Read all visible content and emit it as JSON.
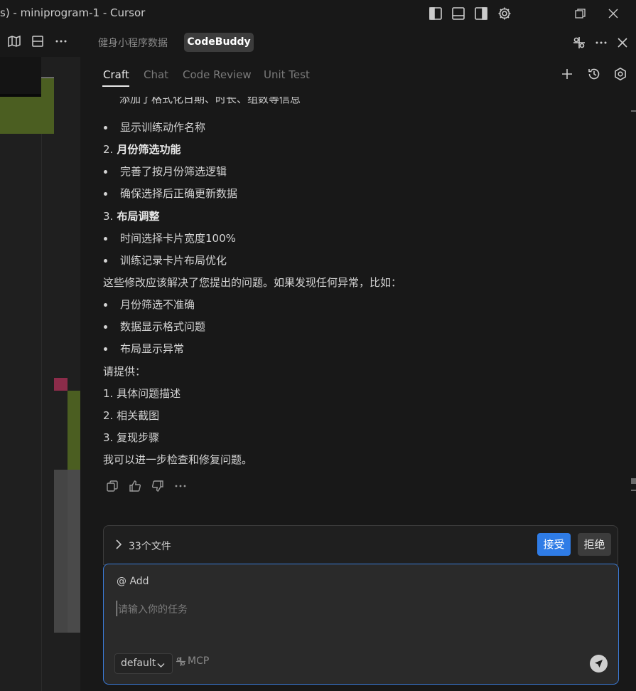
{
  "window": {
    "title": "s) - miniprogram-1 - Cursor"
  },
  "panel": {
    "inactive_tab": "健身小程序数据",
    "active_tab": "CodeBuddy",
    "subtabs": [
      "Craft",
      "Chat",
      "Code Review",
      "Unit Test"
    ]
  },
  "chat": {
    "cut_line": "添加了格式化日期、时长、组数等信息",
    "lines": [
      {
        "type": "bullet",
        "text": "显示训练动作名称"
      },
      {
        "type": "numbered",
        "num": "2.",
        "text": "月份筛选功能"
      },
      {
        "type": "bullet",
        "text": "完善了按月份筛选逻辑"
      },
      {
        "type": "bullet",
        "text": "确保选择后正确更新数据"
      },
      {
        "type": "numbered",
        "num": "3.",
        "text": "布局调整"
      },
      {
        "type": "bullet",
        "text": "时间选择卡片宽度100%"
      },
      {
        "type": "bullet",
        "text": "训练记录卡片布局优化"
      },
      {
        "type": "para",
        "text": "这些修改应该解决了您提出的问题。如果发现任何异常，比如："
      },
      {
        "type": "bullet",
        "text": "月份筛选不准确"
      },
      {
        "type": "bullet",
        "text": "数据显示格式问题"
      },
      {
        "type": "bullet",
        "text": "布局显示异常"
      },
      {
        "type": "para",
        "text": "请提供："
      },
      {
        "type": "para",
        "text": "1. 具体问题描述"
      },
      {
        "type": "para",
        "text": "2. 相关截图"
      },
      {
        "type": "para",
        "text": "3. 复现步骤"
      },
      {
        "type": "para",
        "text": "我可以进一步检查和修复问题。"
      }
    ]
  },
  "files": {
    "label": "33个文件",
    "accept_label": "接受",
    "reject_label": "拒绝"
  },
  "input": {
    "add_label": "@ Add",
    "placeholder": "请输入你的任务",
    "model": "default",
    "mcp_label": "MCP"
  },
  "colors": {
    "accent": "#2f7ce6",
    "input_border": "#3b7ad6",
    "code_green": "#4b5e21",
    "code_pink": "#8c2c4a"
  },
  "icons": [
    "map-icon",
    "split-editor-icon",
    "ellipsis-icon",
    "toggle-primary-sidebar-icon",
    "toggle-panel-icon",
    "toggle-secondary-sidebar-icon",
    "settings-gear-icon",
    "restore-window-icon",
    "close-window-icon",
    "codebuddy-logo-icon",
    "plus-icon",
    "history-icon",
    "settings-icon",
    "copy-icon",
    "thumbs-up-icon",
    "thumbs-down-icon",
    "chevron-right-icon",
    "chevron-down-icon",
    "mcp-icon",
    "send-icon"
  ]
}
